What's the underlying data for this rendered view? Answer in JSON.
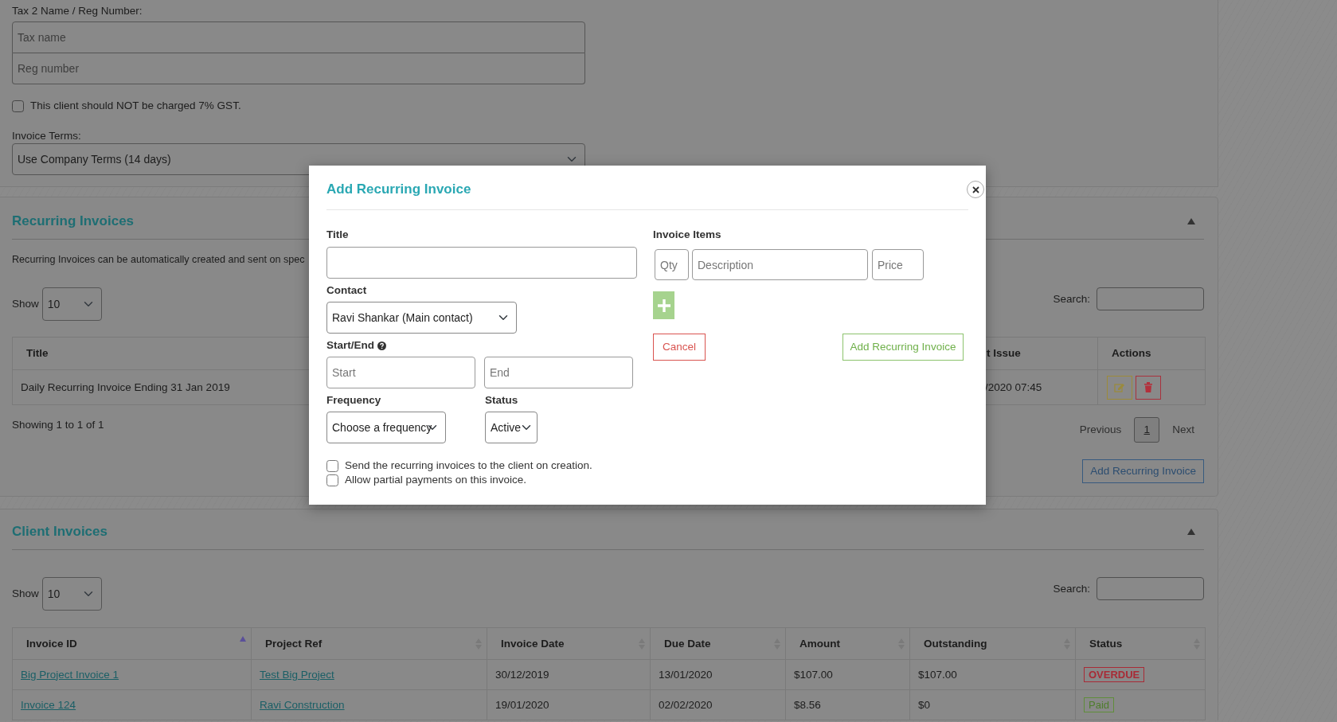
{
  "settings_panel": {
    "tax_label": "Tax 2 Name / Reg Number:",
    "tax_name_placeholder": "Tax name",
    "reg_number_placeholder": "Reg number",
    "gst_checkbox": {
      "label": "This client should NOT be charged 7% GST.",
      "checked": false
    },
    "terms_label": "Invoice Terms:",
    "terms_value": "Use Company Terms (14 days)"
  },
  "recurring_invoices": {
    "title": "Recurring Invoices",
    "expanded": true,
    "description": "Recurring Invoices can be automatically created and sent on spec",
    "show_label": "Show",
    "page_size": "10",
    "search_label": "Search:",
    "columns": [
      "Title",
      "t Issue",
      "Actions"
    ],
    "rows": [
      {
        "title": "Daily Recurring Invoice Ending 31 Jan 2019",
        "issue": "/2020 07:45"
      }
    ],
    "summary": "Showing 1 to 1 of 1",
    "previous": "Previous",
    "pages": [
      {
        "label": "1",
        "selected": true
      }
    ],
    "next": "Next",
    "add_button": "Add Recurring Invoice"
  },
  "client_invoices": {
    "title": "Client Invoices",
    "expanded": true,
    "show_label": "Show",
    "page_size": "10",
    "search_label": "Search:",
    "columns": [
      {
        "label": "Invoice ID",
        "sorted": true
      },
      {
        "label": "Project Ref",
        "sorted": false
      },
      {
        "label": "Invoice Date",
        "sorted": false
      },
      {
        "label": "Due Date",
        "sorted": false
      },
      {
        "label": "Amount",
        "sorted": false
      },
      {
        "label": "Outstanding",
        "sorted": false
      },
      {
        "label": "Status",
        "sorted": false
      }
    ],
    "rows": [
      {
        "invoice_id": "Big Project Invoice 1",
        "project_ref": "Test Big Project",
        "invoice_date": "30/12/2019",
        "due_date": "13/01/2020",
        "amount": "$107.00",
        "outstanding": "$107.00",
        "status": {
          "label": "OVERDUE",
          "kind": "overdue"
        }
      },
      {
        "invoice_id": "Invoice 124",
        "project_ref": "Ravi Construction",
        "invoice_date": "19/01/2020",
        "due_date": "02/02/2020",
        "amount": "$8.56",
        "outstanding": "$0",
        "status": {
          "label": "Paid",
          "kind": "paid"
        }
      }
    ]
  },
  "modal": {
    "title": "Add Recurring Invoice",
    "title_label": "Title",
    "contact_label": "Contact",
    "contact_value": "Ravi Shankar (Main contact)",
    "start_end_label": "Start/End",
    "start_placeholder": "Start",
    "end_placeholder": "End",
    "frequency_label": "Frequency",
    "frequency_value": "Choose a frequency",
    "status_label": "Status",
    "status_value": "Active",
    "checkboxes": [
      {
        "label": "Send the recurring invoices to the client on creation.",
        "checked": false
      },
      {
        "label": "Allow partial payments on this invoice.",
        "checked": false
      }
    ],
    "invoice_items_label": "Invoice Items",
    "qty_placeholder": "Qty",
    "description_placeholder": "Description",
    "price_placeholder": "Price",
    "cancel_button": "Cancel",
    "submit_button": "Add Recurring Invoice"
  }
}
